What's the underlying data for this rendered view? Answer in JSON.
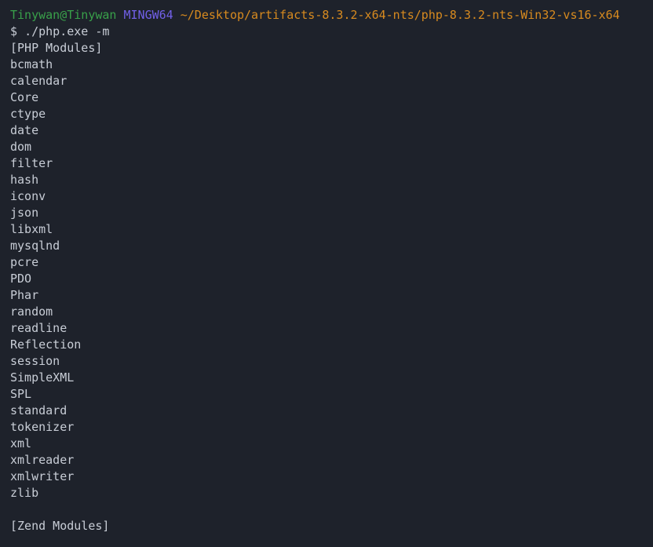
{
  "terminal": {
    "background_color": "#1e222b",
    "default_text_color": "#c8cdd6",
    "prompt": {
      "user_host": "Tinywan@Tinywan",
      "user_host_color": "#39a04a",
      "shell": "MINGW64",
      "shell_color": "#7160e8",
      "path": "~/Desktop/artifacts-8.3.2-x64-nts/php-8.3.2-nts-Win32-vs16-x64",
      "path_color": "#d78a1f"
    },
    "command_line": {
      "symbol": "$",
      "command": "./php.exe -m"
    },
    "output": {
      "php_modules_header": "[PHP Modules]",
      "php_modules": [
        "bcmath",
        "calendar",
        "Core",
        "ctype",
        "date",
        "dom",
        "filter",
        "hash",
        "iconv",
        "json",
        "libxml",
        "mysqlnd",
        "pcre",
        "PDO",
        "Phar",
        "random",
        "readline",
        "Reflection",
        "session",
        "SimpleXML",
        "SPL",
        "standard",
        "tokenizer",
        "xml",
        "xmlreader",
        "xmlwriter",
        "zlib"
      ],
      "zend_modules_header": "[Zend Modules]"
    }
  }
}
